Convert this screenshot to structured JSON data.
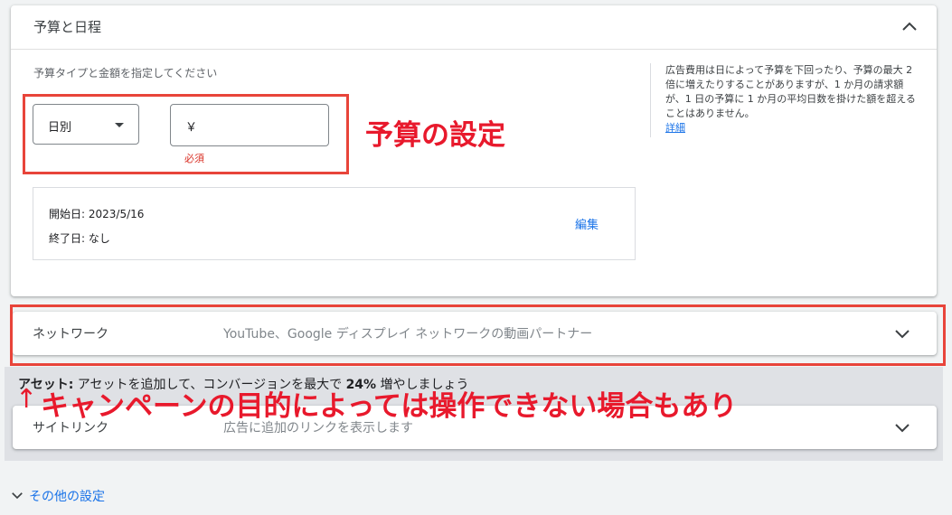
{
  "budget_card": {
    "title": "予算と日程",
    "instruction": "予算タイプと金額を指定してください",
    "budget_type": "日別",
    "currency": "￥",
    "required": "必須",
    "start_date": "開始日: 2023/5/16",
    "end_date": "終了日: なし",
    "edit": "編集",
    "note_text": "広告費用は日によって予算を下回ったり、予算の最大 2 倍に増えたりすることがありますが、1 か月の請求額が、1 日の予算に 1 か月の平均日数を掛けた額を超えることはありません。",
    "note_link": "詳細"
  },
  "network_row": {
    "label": "ネットワーク",
    "description": "YouTube、Google ディスプレイ ネットワークの動画パートナー"
  },
  "asset": {
    "label": "アセット:",
    "text_before": " アセットを追加して、コンバージョンを最大で ",
    "percent": "24%",
    "text_after": " 増やしましょう"
  },
  "sitelink_row": {
    "label": "サイトリンク",
    "description": "広告に追加のリンクを表示します"
  },
  "more_settings": "その他の設定",
  "annotations": {
    "budget_label": "予算の設定",
    "objective_note": "キャンペーンの目的によっては操作できない場合もあり",
    "arrow": "↑",
    "color": "#e8443a"
  }
}
